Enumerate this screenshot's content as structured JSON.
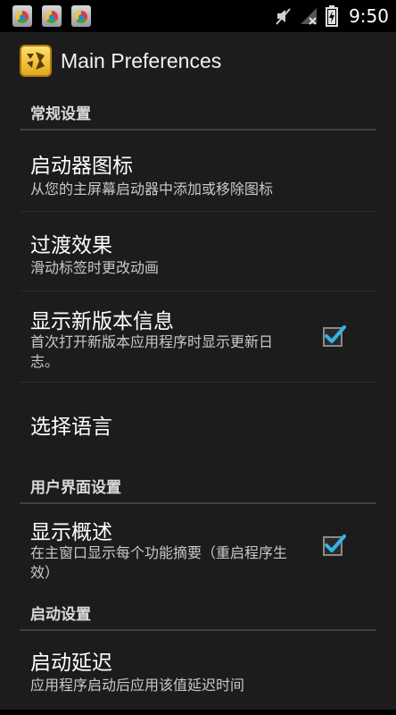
{
  "status_bar": {
    "time": "9:50",
    "notification_icons": [
      "app-notification-icon",
      "app-notification-icon",
      "app-notification-icon"
    ],
    "icons": [
      "muted-speaker-icon",
      "no-signal-icon",
      "battery-charging-icon"
    ]
  },
  "action_bar": {
    "title": "Main Preferences",
    "icon": "app-logo-icon"
  },
  "categories": {
    "general": "常规设置",
    "ui": "用户界面设置",
    "startup": "启动设置"
  },
  "prefs": {
    "launcher_icon": {
      "title": "启动器图标",
      "summary": "从您的主屏幕启动器中添加或移除图标"
    },
    "transition": {
      "title": "过渡效果",
      "summary": "滑动标签时更改动画"
    },
    "new_version": {
      "title": "显示新版本信息",
      "summary": "首次打开新版本应用程序时显示更新日志。",
      "checked": true
    },
    "language": {
      "title": "选择语言"
    },
    "overview": {
      "title": "显示概述",
      "summary": "在主窗口显示每个功能摘要（重启程序生效）",
      "checked": true
    },
    "startup_delay": {
      "title": "启动延迟",
      "summary": "应用程序启动后应用该值延迟时间"
    }
  },
  "colors": {
    "background": "#1c1c1c",
    "status_bar": "#000000",
    "accent_check": "#33b5e5",
    "divider": "#3f3f3f"
  }
}
